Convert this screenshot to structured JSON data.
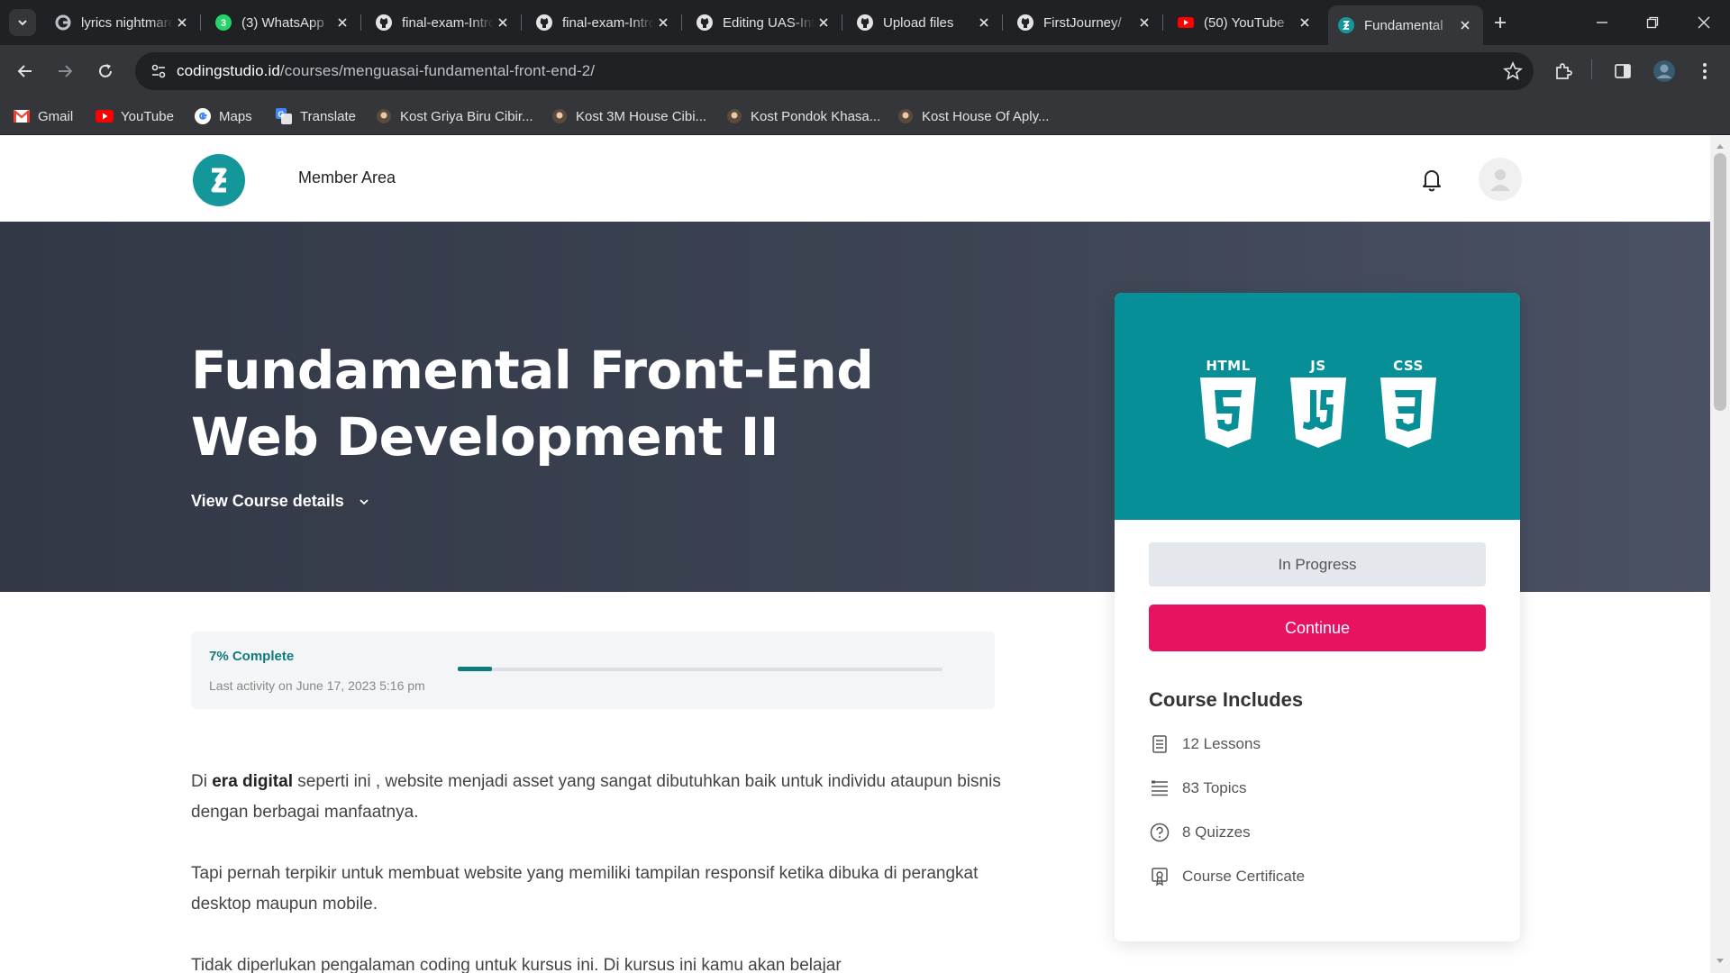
{
  "browser": {
    "tabs": [
      {
        "title": "lyrics nightmare",
        "icon": "google-icon",
        "active": false
      },
      {
        "title": "(3) WhatsApp",
        "icon": "whatsapp-icon",
        "active": false
      },
      {
        "title": "final-exam-Intro",
        "icon": "github-icon",
        "active": false
      },
      {
        "title": "final-exam-Intro",
        "icon": "github-icon",
        "active": false
      },
      {
        "title": "Editing UAS-Intro",
        "icon": "github-icon",
        "active": false
      },
      {
        "title": "Upload files",
        "icon": "github-icon",
        "active": false
      },
      {
        "title": "FirstJourney/",
        "icon": "github-icon",
        "active": false
      },
      {
        "title": "(50) YouTube",
        "icon": "youtube-icon",
        "active": false
      },
      {
        "title": "Fundamental",
        "icon": "codingstudio-icon",
        "active": true
      }
    ],
    "whatsapp_badge": "3",
    "url_host": "codingstudio.id",
    "url_path": "/courses/menguasai-fundamental-front-end-2/",
    "bookmarks": [
      {
        "label": "Gmail",
        "icon": "gmail-icon"
      },
      {
        "label": "YouTube",
        "icon": "youtube-icon"
      },
      {
        "label": "Maps",
        "icon": "google-icon"
      },
      {
        "label": "Translate",
        "icon": "translate-icon"
      },
      {
        "label": "Kost Griya Biru Cibir...",
        "icon": "kost-icon"
      },
      {
        "label": "Kost 3M House Cibi...",
        "icon": "kost-icon"
      },
      {
        "label": "Kost Pondok Khasa...",
        "icon": "kost-icon"
      },
      {
        "label": "Kost House Of Aply...",
        "icon": "kost-icon"
      }
    ]
  },
  "site": {
    "nav_label": "Member Area"
  },
  "course": {
    "title": "Fundamental Front-End Web Development II",
    "view_details": "View Course details",
    "progress_label": "7% Complete",
    "progress_fraction": 0.07,
    "last_activity": "Last activity on June 17, 2023 5:16 pm",
    "description": {
      "p1_before": "Di ",
      "p1_bold": "era digital",
      "p1_after": " seperti ini , website menjadi asset yang sangat dibutuhkan baik untuk individu ataupun bisnis dengan berbagai manfaatnya.",
      "p2": "Tapi pernah terpikir untuk membuat website yang memiliki tampilan responsif ketika dibuka di perangkat desktop maupun mobile.",
      "p3": "Tidak diperlukan pengalaman coding untuk kursus ini. Di kursus ini kamu akan belajar"
    }
  },
  "sidebar": {
    "tech_labels": [
      "HTML",
      "JS",
      "CSS"
    ],
    "status": "In Progress",
    "continue_label": "Continue",
    "includes_title": "Course Includes",
    "includes": [
      {
        "label": "12 Lessons",
        "icon": "lessons-icon"
      },
      {
        "label": "83 Topics",
        "icon": "topics-icon"
      },
      {
        "label": "8 Quizzes",
        "icon": "quiz-icon"
      },
      {
        "label": "Course Certificate",
        "icon": "certificate-icon"
      }
    ]
  },
  "colors": {
    "accent_teal": "#0f7a7e",
    "card_teal": "#078f97",
    "continue_pink": "#e91260",
    "hero_bg": "#3c4352"
  }
}
